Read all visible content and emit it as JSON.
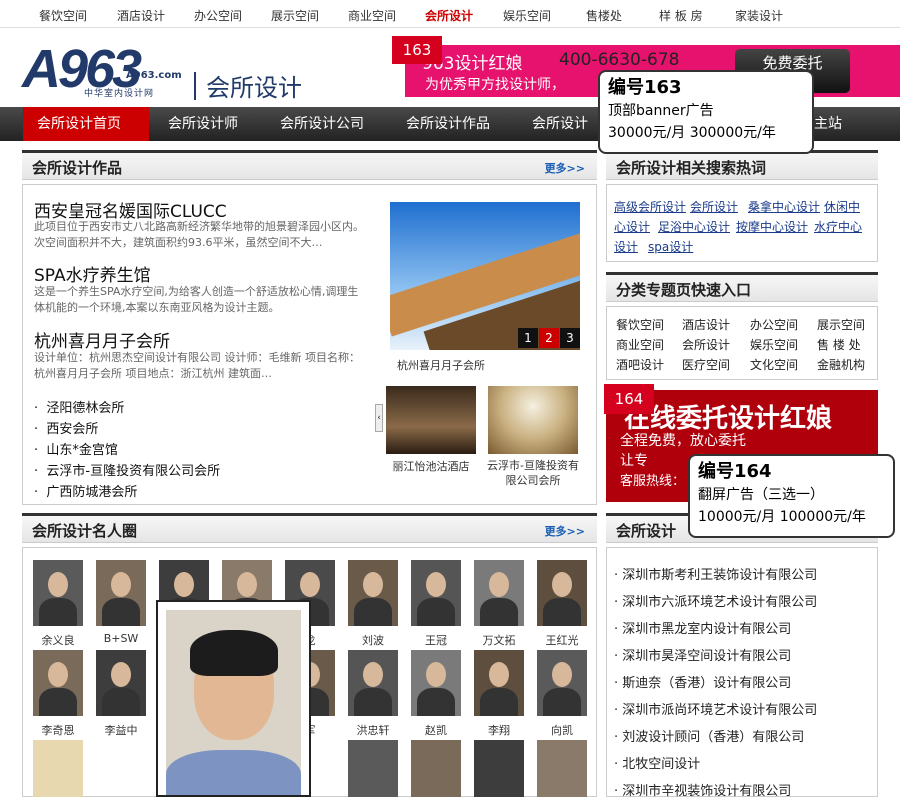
{
  "top_nav": [
    "餐饮空间",
    "酒店设计",
    "办公空间",
    "展示空间",
    "商业空间",
    "会所设计",
    "娱乐空间",
    "售楼处",
    "样 板 房",
    "家装设计"
  ],
  "top_nav_active": "会所设计",
  "logo": {
    "text": "A963",
    "domain": "A963.com",
    "subtitle": "中华室内设计网"
  },
  "site_title": "会所设计",
  "banner": {
    "tag": "163",
    "line1": "963设计红娘",
    "phone": "400-6630-678",
    "line2": "为优秀甲方找设计师，",
    "button": "免费委托"
  },
  "callout_163": {
    "title": "编号163",
    "line1": "顶部banner广告",
    "line2": "30000元/月   300000元/年"
  },
  "main_nav": [
    "会所设计首页",
    "会所设计师",
    "会所设计公司",
    "会所设计作品",
    "会所设计",
    "主站"
  ],
  "works": {
    "title": "会所设计作品",
    "more": "更多>>",
    "articles": [
      {
        "title": "西安皇冠名媛国际CLUCC",
        "desc": "此项目位于西安市丈八北路高新经济繁华地带的旭景碧泽园小区内。次空间面积并不大，建筑面积约93.6平米，虽然空间不大…"
      },
      {
        "title": "SPA水疗养生馆",
        "desc": "这是一个养生SPA水疗空间,为给客人创造一个舒适放松心情,调理生体机能的一个环境,本案以东南亚风格为设计主题。"
      },
      {
        "title": "杭州喜月月子会所",
        "desc": "设计单位：杭州思杰空间设计有限公司 设计师：毛维新 项目名称：杭州喜月月子会所 项目地点：浙江杭州 建筑面…"
      }
    ],
    "list": [
      "泾阳德林会所",
      "西安会所",
      "山东*金宫馆",
      "云浮市-亘隆投资有限公司会所",
      "广西防城港会所"
    ],
    "slide_caption": "杭州喜月月子会所",
    "slide_nums": [
      "1",
      "2",
      "3"
    ],
    "thumbs": [
      {
        "caption": "丽江怡池沽酒店"
      },
      {
        "caption": "云浮市-亘隆投资有限公司会所"
      }
    ]
  },
  "hot_search": {
    "title": "会所设计相关搜索热词",
    "lines": [
      [
        "高级会所设计",
        "会所设计",
        "桑拿中心设计",
        "休闲中"
      ],
      [
        "心设计",
        "足浴中心设计",
        "按摩中心设计",
        "水疗中心"
      ],
      [
        "设计",
        "spa设计"
      ]
    ]
  },
  "categories": {
    "title": "分类专题页快速入口",
    "rows": [
      [
        "餐饮空间",
        "酒店设计",
        "办公空间",
        "展示空间"
      ],
      [
        "商业空间",
        "会所设计",
        "娱乐空间",
        "售 楼 处"
      ],
      [
        "酒吧设计",
        "医疗空间",
        "文化空间",
        "金融机构"
      ]
    ]
  },
  "ad_164": {
    "tag": "164",
    "line1": "在线委托设计红娘",
    "line2": "全程免费，放心委托",
    "line3": "让专",
    "line4": "客服热线："
  },
  "callout_164": {
    "title": "编号164",
    "line1": "翻屏广告（三选一）",
    "line2": "10000元/月   100000元/年"
  },
  "designers": {
    "title": "会所设计名人圈",
    "more": "更多>>",
    "row1": [
      "余义良",
      "B+SW",
      "",
      "",
      "",
      "龙",
      "刘波",
      "王冠",
      "万文拓",
      "王红光"
    ],
    "row2": [
      "李奇恩",
      "李益中",
      "",
      "",
      "",
      "军",
      "洪忠轩",
      "赵凯",
      "李翔",
      "向凯"
    ]
  },
  "companies": {
    "title": "会所设计",
    "items": [
      "深圳市斯考利王装饰设计有限公司",
      "深圳市六派环境艺术设计有限公司",
      "深圳市黑龙室内设计有限公司",
      "深圳市昊泽空间设计有限公司",
      "斯迪奈（香港）设计有限公司",
      "深圳市派尚环境艺术设计有限公司",
      "刘波设计顾问（香港）有限公司",
      "北牧空间设计",
      "深圳市辛视装饰设计有限公司"
    ]
  }
}
